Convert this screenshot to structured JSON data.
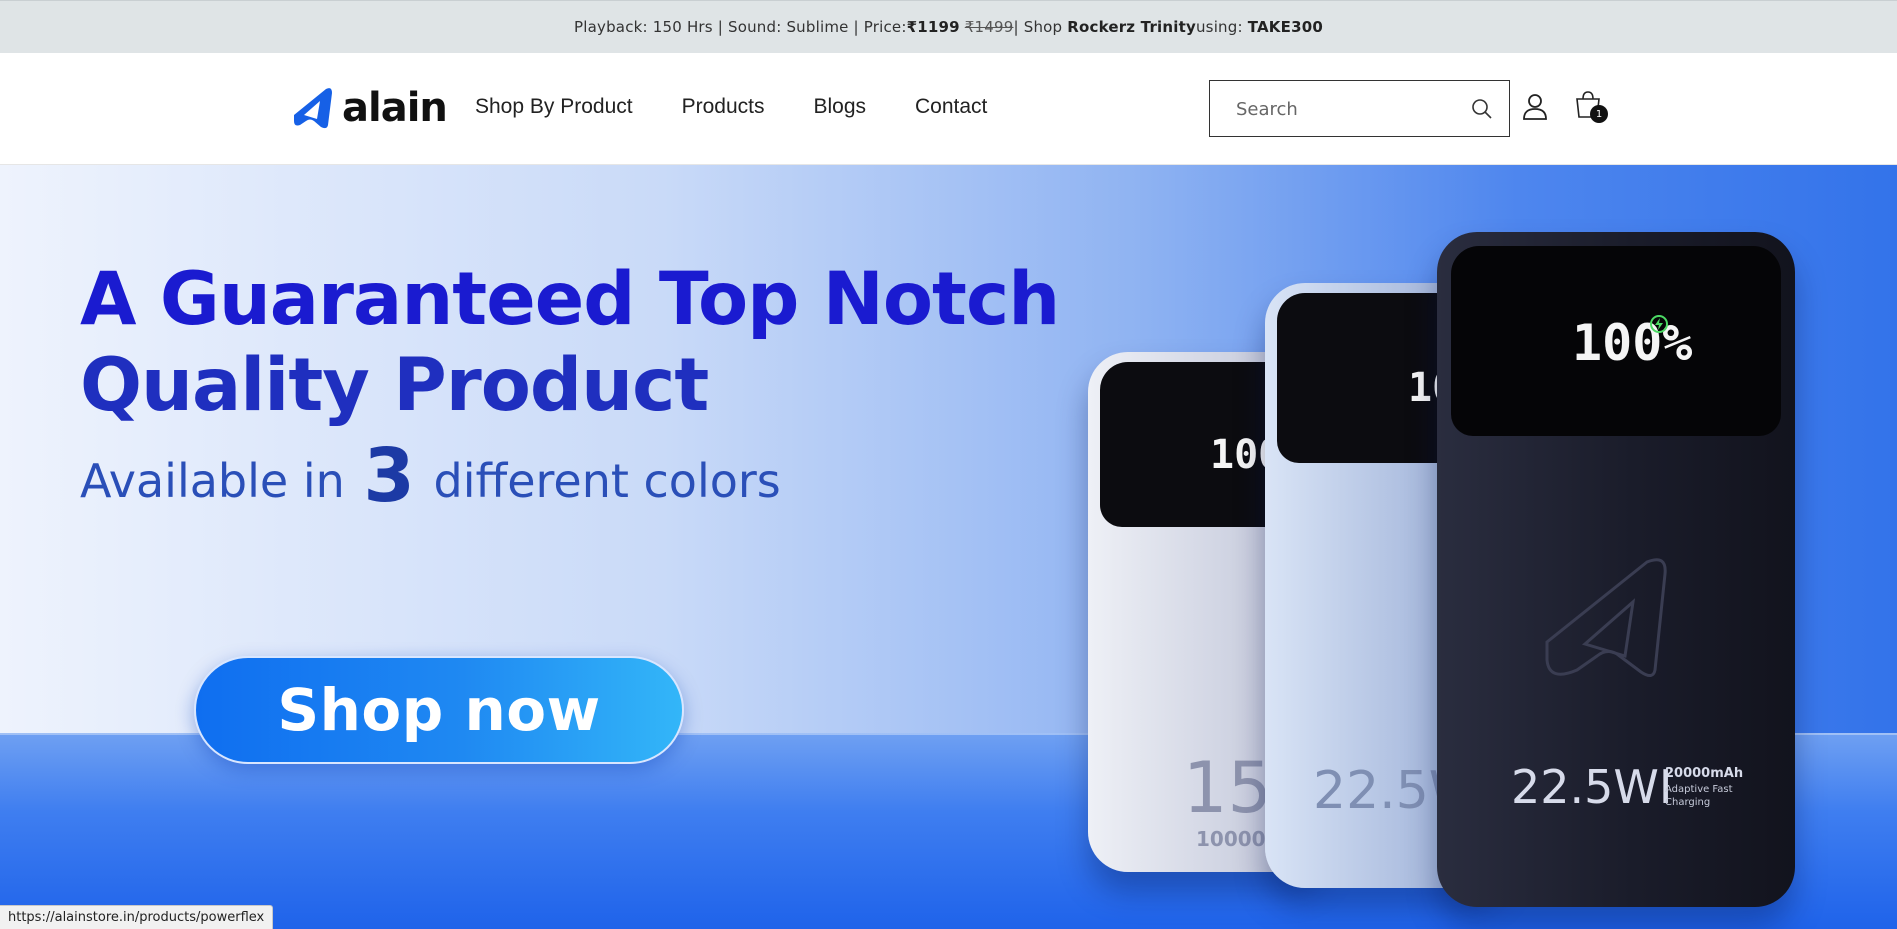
{
  "announcement": {
    "prefix": "Playback: 150 Hrs | Sound: Sublime | Price: ",
    "price_current": "₹1199",
    "price_old": "₹1499",
    "middle": " | Shop ",
    "product": "Rockerz Trinity",
    "using": " using: ",
    "code": "TAKE300"
  },
  "header": {
    "logo_text": "alain",
    "nav": [
      "Shop By Product",
      "Products",
      "Blogs",
      "Contact"
    ],
    "search_placeholder": "Search",
    "cart_count": "1"
  },
  "hero": {
    "headline_line1": "A Guaranteed Top Notch",
    "headline_line2": "Quality Product",
    "sub_before": "Available in",
    "sub_number": "3",
    "sub_after": "different colors",
    "cta_label": "Shop now",
    "products": {
      "white": {
        "screen": "100",
        "watt": "15",
        "capacity": "10000m"
      },
      "blue": {
        "screen": "10",
        "watt": "22.5W"
      },
      "black": {
        "screen": "100%",
        "watt": "22.5WI",
        "capacity": "20000mAh",
        "tag1": "Adaptive Fast",
        "tag2": "Charging"
      }
    }
  },
  "status_bar": {
    "url": "https://alainstore.in/products/powerflex"
  },
  "colors": {
    "accent": "#1a1bd0",
    "button": "#1f89f2",
    "announce_bg": "#dfe4e6"
  }
}
